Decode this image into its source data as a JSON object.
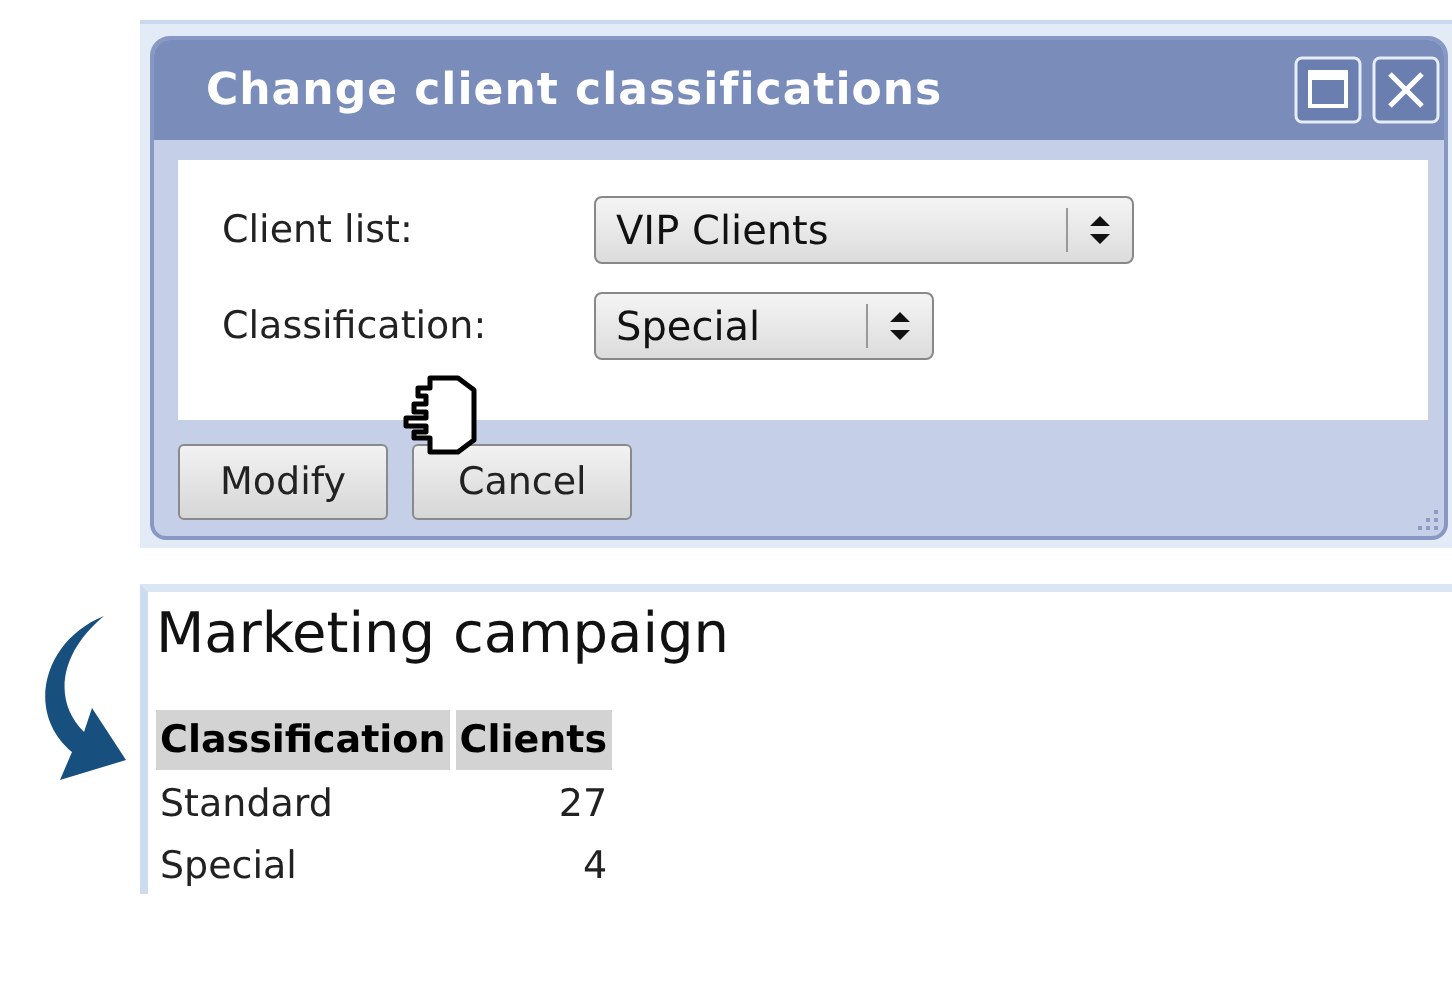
{
  "dialog": {
    "title": "Change client classifications",
    "fields": [
      {
        "label": "Client list:",
        "value": "VIP Clients",
        "kind": "select"
      },
      {
        "label": "Classification:",
        "value": "Special",
        "kind": "select"
      }
    ],
    "buttons": [
      "Modify",
      "Cancel"
    ]
  },
  "report": {
    "title": "Marketing campaign",
    "columns": [
      "Classification",
      "Clients"
    ],
    "rows": [
      {
        "classification": "Standard",
        "clients": "27"
      },
      {
        "classification": "Special",
        "clients": "4"
      }
    ]
  }
}
